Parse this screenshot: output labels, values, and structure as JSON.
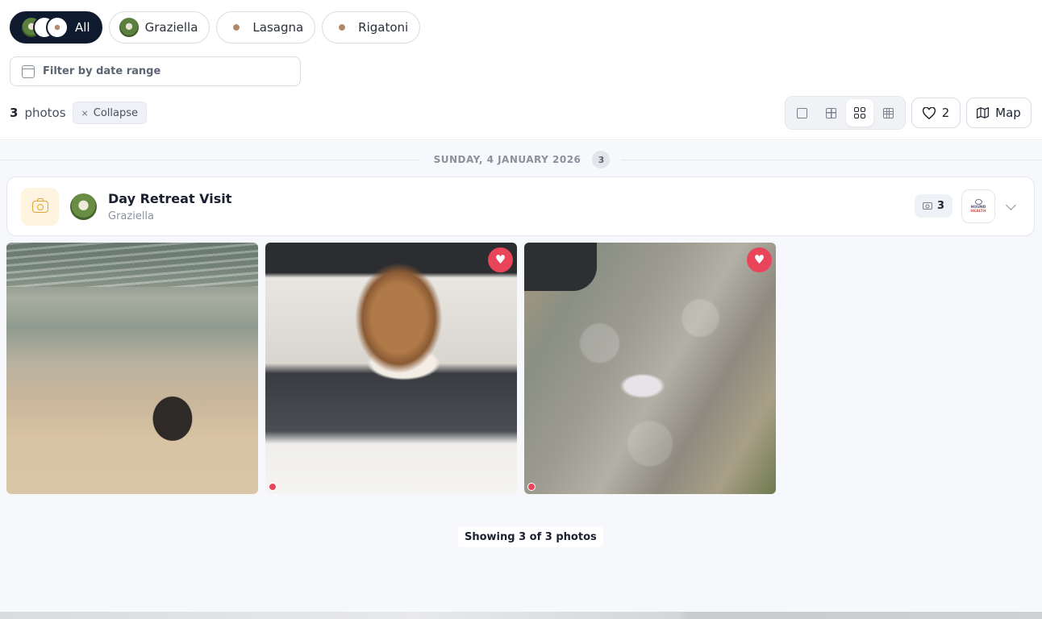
{
  "filters": {
    "pets": [
      {
        "label": "All",
        "active": true
      },
      {
        "label": "Graziella",
        "active": false
      },
      {
        "label": "Lasagna",
        "active": false
      },
      {
        "label": "Rigatoni",
        "active": false
      }
    ],
    "date_range_label": "Filter by date range"
  },
  "toolbar": {
    "count": "3",
    "count_label": "photos",
    "collapse_label": "Collapse",
    "favourites_count": "2",
    "map_label": "Map",
    "grid_options": [
      "single",
      "large-grid",
      "medium-grid",
      "small-grid"
    ],
    "selected_grid": "medium-grid"
  },
  "day_group": {
    "date_label": "SUNDAY, 4 JANUARY 2026",
    "count": "3"
  },
  "visit": {
    "title": "Day Retreat Visit",
    "pet_name": "Graziella",
    "photo_count": "3",
    "clinic_logo_line1": "HOUND",
    "clinic_logo_line2": "HEALTH"
  },
  "photos": [
    {
      "description": "dog on beach",
      "favourite": false,
      "status_dot": false
    },
    {
      "description": "long-haired dog portrait",
      "favourite": true,
      "status_dot": true
    },
    {
      "description": "dog lying on footpath",
      "favourite": true,
      "status_dot": true
    }
  ],
  "footer": {
    "showing_text": "Showing 3 of 3 photos"
  },
  "colors": {
    "accent_dark": "#0f1a2e",
    "favourite_red": "#e8445a",
    "visit_icon_bg": "#fff4e0",
    "visit_icon_stroke": "#e3a23b"
  }
}
